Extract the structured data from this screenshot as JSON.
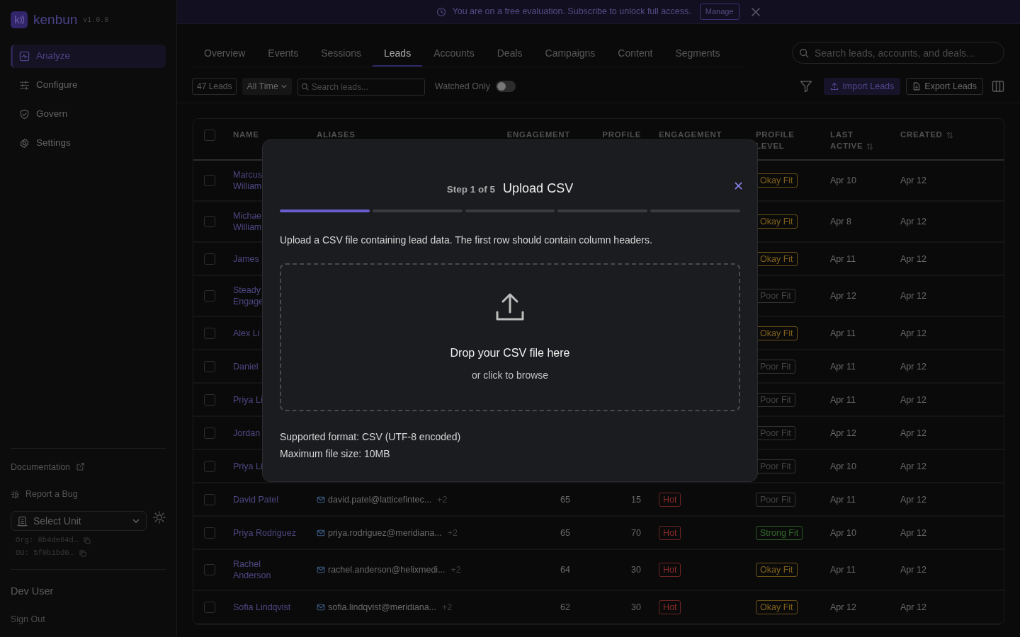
{
  "sidebar": {
    "logo": {
      "mark": "k",
      "name": "kenbun",
      "version": "v1.0.0"
    },
    "nav": [
      {
        "label": "Analyze",
        "kind": "analyze",
        "selected": true
      },
      {
        "label": "Configure",
        "kind": "configure",
        "selected": false
      },
      {
        "label": "Govern",
        "kind": "govern",
        "selected": false
      },
      {
        "label": "Settings",
        "kind": "settings",
        "selected": false
      }
    ],
    "links": [
      {
        "label": "Documentation",
        "kind": "external"
      },
      {
        "label": "Report a Bug",
        "kind": "bug"
      }
    ],
    "unit_select": {
      "value": "Select Unit"
    },
    "ids": [
      "Org: 8b4de64d…",
      "OU: 5f0b1bd0…"
    ],
    "user": {
      "name": "Dev User",
      "sign_out": "Sign Out"
    }
  },
  "banner": {
    "message": "You are on a free evaluation. Subscribe to unlock full access.",
    "button": "Manage"
  },
  "tabs": [
    {
      "label": "Overview",
      "selected": false
    },
    {
      "label": "Events",
      "selected": false
    },
    {
      "label": "Sessions",
      "selected": false
    },
    {
      "label": "Leads",
      "selected": true
    },
    {
      "label": "Accounts",
      "selected": false
    },
    {
      "label": "Deals",
      "selected": false
    },
    {
      "label": "Campaigns",
      "selected": false
    },
    {
      "label": "Content",
      "selected": false
    },
    {
      "label": "Segments",
      "selected": false
    }
  ],
  "global_search": {
    "placeholder": "Search leads, accounts, and deals..."
  },
  "toolbar": {
    "count": "47 Leads",
    "range": "All Time",
    "search": {
      "placeholder": "Search leads..."
    },
    "watched": {
      "label": "Watched Only",
      "on": false
    },
    "import": "Import Leads",
    "export": "Export Leads"
  },
  "table": {
    "header_checked": false,
    "columns": [
      {
        "label": "NAME",
        "sortable": false
      },
      {
        "label": "ALIASES",
        "sortable": false
      },
      {
        "label": "ENGAGEMENT",
        "sortable": false
      },
      {
        "label": "PROFILE",
        "sortable": false
      },
      {
        "label": "ENGAGEMENT",
        "sortable": false
      },
      {
        "label": "PROFILE\nLEVEL",
        "sortable": false
      },
      {
        "label": "LAST\nACTIVE",
        "sortable": true
      },
      {
        "label": "CREATED",
        "sortable": true
      }
    ],
    "rows": [
      {
        "checked": false,
        "name": "Marcus\nWilliam",
        "fit": {
          "label": "Okay Fit",
          "kind": "okay"
        },
        "last_active": "Apr 10",
        "created": "Apr 12"
      },
      {
        "checked": false,
        "name": "Michae\nWilliam",
        "fit": {
          "label": "Okay Fit",
          "kind": "okay"
        },
        "last_active": "Apr 8",
        "created": "Apr 12"
      },
      {
        "checked": false,
        "name": "James",
        "fit": {
          "label": "Okay Fit",
          "kind": "okay"
        },
        "last_active": "Apr 11",
        "created": "Apr 12"
      },
      {
        "checked": false,
        "name": "Steady\nEngage",
        "fit": {
          "label": "Poor Fit",
          "kind": "poor"
        },
        "last_active": "Apr 12",
        "created": "Apr 12"
      },
      {
        "checked": false,
        "name": "Alex Li",
        "fit": {
          "label": "Okay Fit",
          "kind": "okay"
        },
        "last_active": "Apr 11",
        "created": "Apr 12"
      },
      {
        "checked": false,
        "name": "Daniel",
        "fit": {
          "label": "Poor Fit",
          "kind": "poor"
        },
        "last_active": "Apr 11",
        "created": "Apr 12"
      },
      {
        "checked": false,
        "name": "Priya Li",
        "fit": {
          "label": "Poor Fit",
          "kind": "poor"
        },
        "last_active": "Apr 11",
        "created": "Apr 12"
      },
      {
        "checked": false,
        "name": "Jordan",
        "fit": {
          "label": "Poor Fit",
          "kind": "poor"
        },
        "last_active": "Apr 12",
        "created": "Apr 12"
      },
      {
        "checked": false,
        "name": "Priya Li",
        "fit": {
          "label": "Poor Fit",
          "kind": "poor"
        },
        "last_active": "Apr 10",
        "created": "Apr 12"
      },
      {
        "checked": false,
        "name": "David Patel",
        "email": "david.patel@latticefintec...",
        "more": "+2",
        "engagement": "65",
        "profile": "15",
        "tag": {
          "label": "Hot",
          "kind": "hot"
        },
        "fit": {
          "label": "Poor Fit",
          "kind": "poor"
        },
        "last_active": "Apr 11",
        "created": "Apr 12"
      },
      {
        "checked": false,
        "name": "Priya Rodriguez",
        "email": "priya.rodriguez@meridiana...",
        "more": "+2",
        "engagement": "65",
        "profile": "70",
        "tag": {
          "label": "Hot",
          "kind": "hot"
        },
        "fit": {
          "label": "Strong Fit",
          "kind": "strong"
        },
        "last_active": "Apr 10",
        "created": "Apr 12"
      },
      {
        "checked": false,
        "name": "Rachel\nAnderson",
        "email": "rachel.anderson@helixmedi...",
        "more": "+2",
        "engagement": "64",
        "profile": "30",
        "tag": {
          "label": "Hot",
          "kind": "hot"
        },
        "fit": {
          "label": "Okay Fit",
          "kind": "okay"
        },
        "last_active": "Apr 11",
        "created": "Apr 12"
      },
      {
        "checked": false,
        "name": "Sofia Lindqvist",
        "email": "sofia.lindqvist@meridiana...",
        "more": "+2",
        "engagement": "62",
        "profile": "30",
        "tag": {
          "label": "Hot",
          "kind": "hot"
        },
        "fit": {
          "label": "Okay Fit",
          "kind": "okay"
        },
        "last_active": "Apr 12",
        "created": "Apr 12"
      }
    ]
  },
  "modal": {
    "step": "Step 1 of 5",
    "title": "Upload CSV",
    "steps": [
      {
        "done": true
      },
      {
        "done": false
      },
      {
        "done": false
      },
      {
        "done": false
      },
      {
        "done": false
      }
    ],
    "intro": "Upload a CSV file containing lead data. The first row should contain column headers.",
    "drop": {
      "title": "Drop your CSV file here",
      "hint": "or click to browse"
    },
    "notes": [
      "Supported format: CSV (UTF-8 encoded)",
      "Maximum file size: 10MB"
    ]
  }
}
